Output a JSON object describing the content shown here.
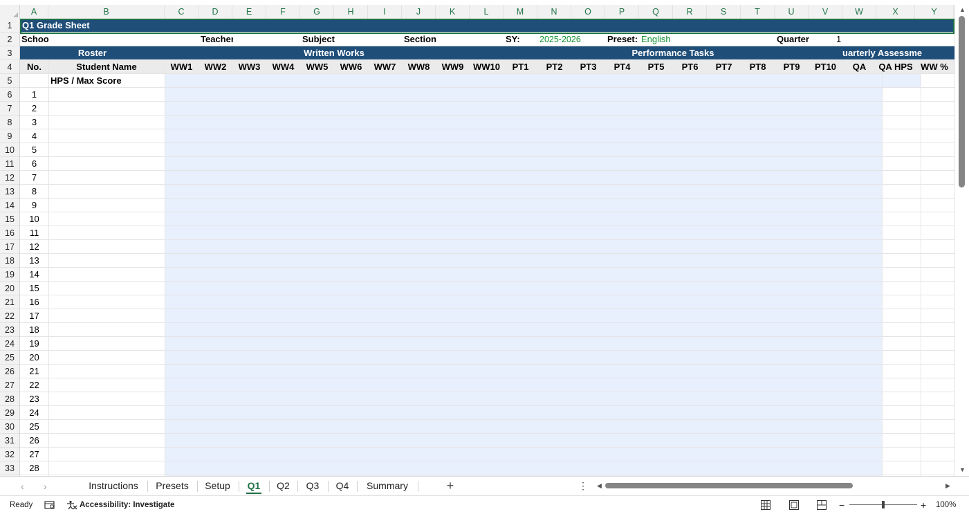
{
  "columns": [
    "A",
    "B",
    "C",
    "D",
    "E",
    "F",
    "G",
    "H",
    "I",
    "J",
    "K",
    "L",
    "M",
    "N",
    "O",
    "P",
    "Q",
    "R",
    "S",
    "T",
    "U",
    "V",
    "W",
    "X",
    "Y"
  ],
  "row_numbers": [
    1,
    2,
    3,
    4,
    5,
    6,
    7,
    8,
    9,
    10,
    11,
    12,
    13,
    14,
    15,
    16,
    17,
    18,
    19,
    20,
    21,
    22,
    23,
    24,
    25,
    26,
    27,
    28,
    29,
    30,
    31,
    32,
    33
  ],
  "title": "Q1 Grade Sheet",
  "info_row": {
    "school_label": "School",
    "teacher_label": "Teacher",
    "subject_label": "Subject",
    "section_label": "Section",
    "sy_label": "SY:",
    "sy_value": "2025-2026",
    "preset_label": "Preset:",
    "preset_value": "English",
    "quarter_label": "Quarter",
    "quarter_value": "1"
  },
  "group_headers": {
    "roster": "Roster",
    "written_works": "Written Works",
    "performance_tasks": "Performance Tasks",
    "quarterly_assessment": "uarterly Assessme"
  },
  "column_headers": [
    "No.",
    "Student Name",
    "WW1",
    "WW2",
    "WW3",
    "WW4",
    "WW5",
    "WW6",
    "WW7",
    "WW8",
    "WW9",
    "WW10",
    "PT1",
    "PT2",
    "PT3",
    "PT4",
    "PT5",
    "PT6",
    "PT7",
    "PT8",
    "PT9",
    "PT10",
    "QA",
    "QA HPS",
    "WW %"
  ],
  "hps_label": "HPS / Max Score",
  "student_numbers": [
    1,
    2,
    3,
    4,
    5,
    6,
    7,
    8,
    9,
    10,
    11,
    12,
    13,
    14,
    15,
    16,
    17,
    18,
    19,
    20,
    21,
    22,
    23,
    24,
    25,
    26,
    27,
    28
  ],
  "sheet_tabs": [
    "Instructions",
    "Presets",
    "Setup",
    "Q1",
    "Q2",
    "Q3",
    "Q4",
    "Summary"
  ],
  "active_tab": "Q1",
  "status": {
    "ready": "Ready",
    "accessibility": "Accessibility: Investigate",
    "zoom": "100%"
  },
  "colors": {
    "header_band": "#1f4e79",
    "score_fill": "#e8effd",
    "accent_green": "#1e7145",
    "value_green": "#0d8f2c"
  },
  "icons": [
    "corner-select-icon",
    "scroll-up-icon",
    "scroll-down-icon",
    "scroll-left-icon",
    "scroll-right-icon",
    "tab-prev-icon",
    "tab-next-icon",
    "add-sheet-icon",
    "more-options-icon",
    "cell-mode-icon",
    "accessibility-icon",
    "normal-view-icon",
    "page-layout-icon",
    "page-break-icon",
    "zoom-out-icon",
    "zoom-in-icon"
  ]
}
